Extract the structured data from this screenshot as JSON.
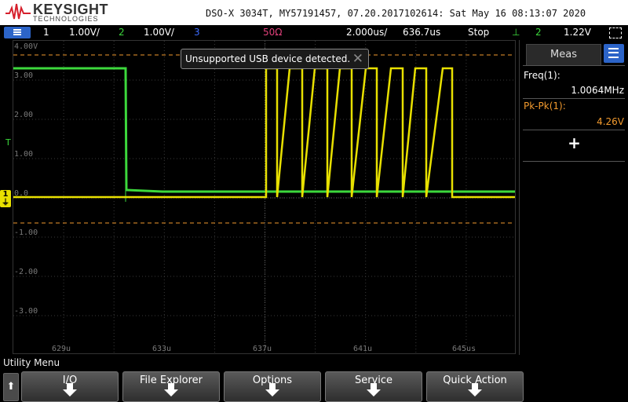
{
  "brand": {
    "name": "KEYSIGHT",
    "sub": "TECHNOLOGIES"
  },
  "device_info": "DSO-X 3034T, MY57191457, 07.20.2017102614: Sat May 16 08:13:07 2020",
  "status": {
    "ch1_num": "1",
    "ch1_scale": "1.00V/",
    "ch2_num": "2",
    "ch2_scale": "1.00V/",
    "ch3_num": "3",
    "impedance": "50Ω",
    "timebase": "2.000us/",
    "delay": "636.7us",
    "run_state": "Stop",
    "trig_source": "2",
    "trig_level": "1.22V"
  },
  "colors": {
    "ch1": "#e8e000",
    "ch2": "#3cd83c",
    "ch3": "#3c6cff",
    "imp": "#e0407a",
    "meas_orange": "#f29a2e"
  },
  "yaxis_labels": [
    "4.00V",
    "3.00",
    "2.00",
    "1.00",
    "0.0",
    "-1.00",
    "-2.00",
    "-3.00"
  ],
  "xaxis_labels": [
    "629u",
    "633u",
    "637u",
    "641u",
    "645us"
  ],
  "toast": {
    "message": "Unsupported USB device detected."
  },
  "meas_panel": {
    "title": "Meas",
    "freq_label": "Freq(1):",
    "freq_value": "1.0064MHz",
    "pkpk_label": "Pk-Pk(1):",
    "pkpk_value": "4.26V",
    "add_label": "+"
  },
  "utility": {
    "title": "Utility Menu",
    "softkeys": [
      "I/O",
      "File Explorer",
      "Options",
      "Service",
      "Quick Action"
    ]
  },
  "markers": {
    "trigger": "T",
    "ch1": "1"
  }
}
